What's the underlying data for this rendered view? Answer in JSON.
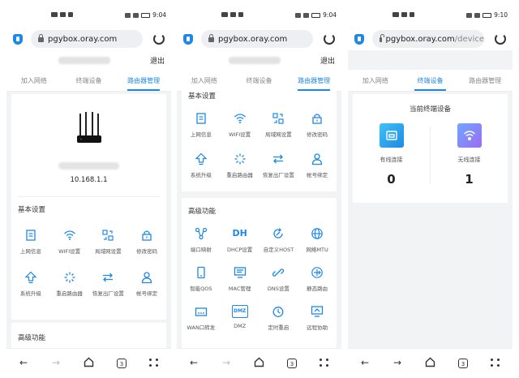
{
  "status": {
    "time_1": "9:04",
    "time_2": "9:04",
    "time_3": "9:10"
  },
  "browser": {
    "url_1": "pgybox.oray.com",
    "url_2": "pgybox.oray.com",
    "url_3_host": "pgybox.oray.com",
    "url_3_path": "/device"
  },
  "account": {
    "logout": "退出"
  },
  "tabs": [
    "加入网络",
    "终端设备",
    "路由器管理"
  ],
  "router": {
    "ip": "10.168.1.1"
  },
  "basic": {
    "title": "基本设置",
    "items": [
      "上网信息",
      "WIFI设置",
      "局域网设置",
      "修改密码",
      "系统升级",
      "重启路由器",
      "恢复出厂设置",
      "帐号绑定"
    ]
  },
  "advanced": {
    "title": "高级功能",
    "items": [
      "端口映射",
      "DHCP设置",
      "自定义HOST",
      "网络MTU",
      "智能QOS",
      "MAC管理",
      "DNS设置",
      "静态路由",
      "WAN口转发",
      "DMZ",
      "定时重启",
      "远程协助"
    ],
    "dh_glyph": "DH",
    "dmz_glyph": "DMZ"
  },
  "devices": {
    "title": "当前终端设备",
    "wired_label": "有线连接",
    "wired_count": "0",
    "wireless_label": "无线连接",
    "wireless_count": "1"
  },
  "nav": {
    "tab_count": "3"
  },
  "colors": {
    "accent": "#1e88e5",
    "wired_gradient_start": "#3ec3f5",
    "wireless_gradient_start": "#6fa8ff",
    "wireless_gradient_end": "#9b6cf2"
  }
}
